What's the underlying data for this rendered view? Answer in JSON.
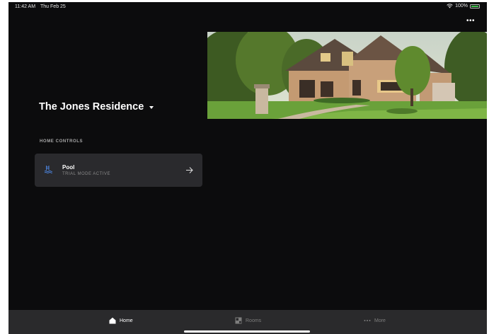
{
  "status_bar": {
    "time": "11:42 AM",
    "date": "Thu Feb 25",
    "battery": "100%"
  },
  "header": {
    "more_label": "•••"
  },
  "home": {
    "residence_name": "The Jones Residence"
  },
  "home_controls": {
    "section_label": "HOME CONTROLS",
    "items": [
      {
        "title": "Pool",
        "subtitle": "TRIAL MODE ACTIVE",
        "icon": "pool-icon"
      }
    ]
  },
  "tab_bar": {
    "tabs": [
      {
        "label": "Home",
        "icon": "home-icon",
        "active": true
      },
      {
        "label": "Rooms",
        "icon": "rooms-icon",
        "active": false
      },
      {
        "label": "More",
        "icon": "more-dots-icon",
        "active": false
      }
    ]
  },
  "colors": {
    "background": "#0c0c0d",
    "card": "#2a2a2d",
    "tab_bar": "#2a2a2c",
    "battery": "#3ec04b",
    "text_primary": "#ffffff",
    "text_secondary": "#8a8a8a"
  }
}
